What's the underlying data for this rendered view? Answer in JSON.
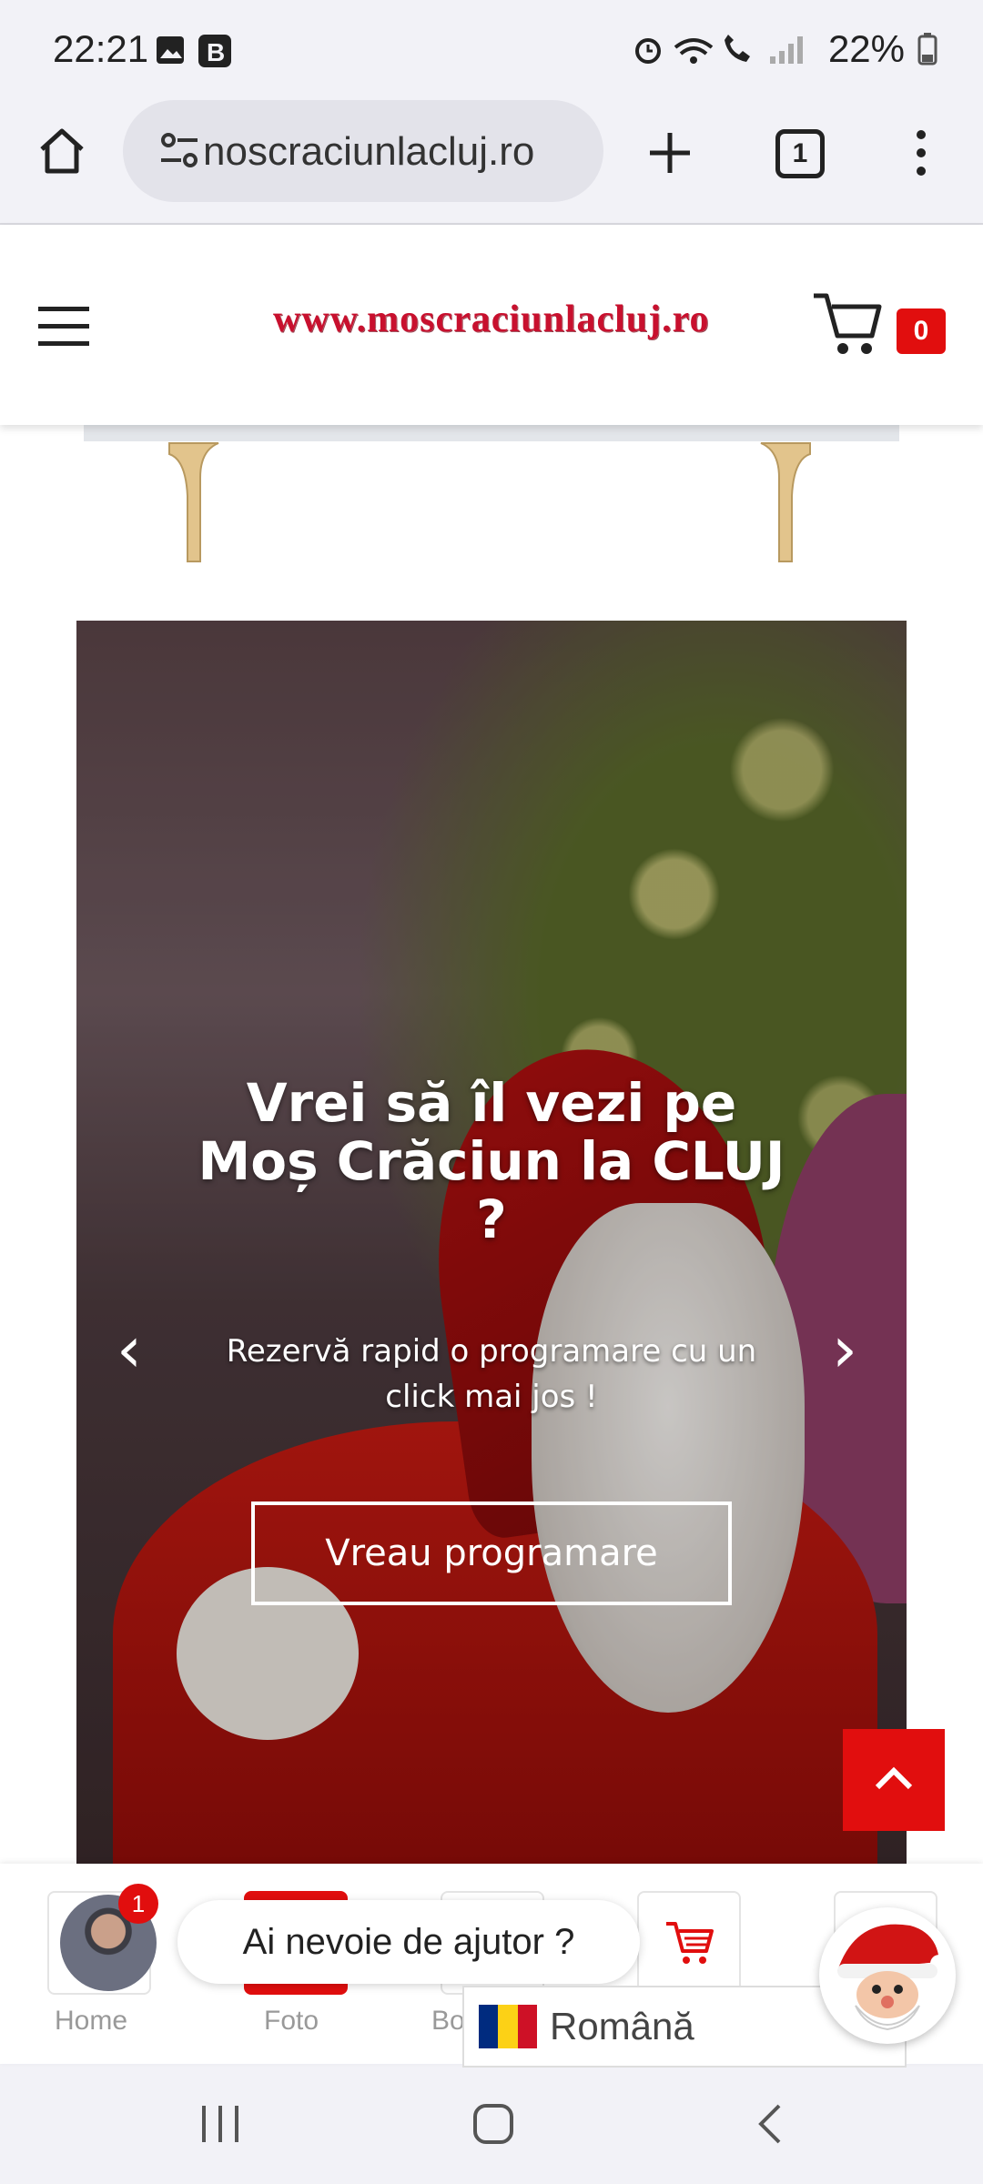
{
  "status_bar": {
    "time": "22:21",
    "left_icons": [
      "image-icon",
      "b-icon"
    ],
    "right_icons": [
      "alarm-icon",
      "wifi-icon",
      "wifi-call-icon",
      "signal-icon"
    ],
    "battery": "22%"
  },
  "browser": {
    "url": "noscraciunlacluj.ro",
    "tab_count": "1"
  },
  "site": {
    "logo_text": "www.moscraciunlacluj.ro",
    "cart_count": "0"
  },
  "hero": {
    "title": "Vrei să îl vezi pe Moș Crăciun la CLUJ ?",
    "subtitle": "Rezervă rapid o programare cu un click mai jos !",
    "button": "Vreau programare",
    "prev": "‹",
    "next": "›"
  },
  "bottom_nav": {
    "items": [
      {
        "label": "Home"
      },
      {
        "label": "Foto"
      },
      {
        "label": "Bo"
      }
    ],
    "notification_count": "1",
    "help_text": "Ai nevoie de ajutor ?",
    "language": "Română"
  },
  "colors": {
    "accent": "#e10e0e",
    "logo": "#c8102e",
    "flag": [
      "#002b7f",
      "#fcd116",
      "#ce1126"
    ]
  }
}
